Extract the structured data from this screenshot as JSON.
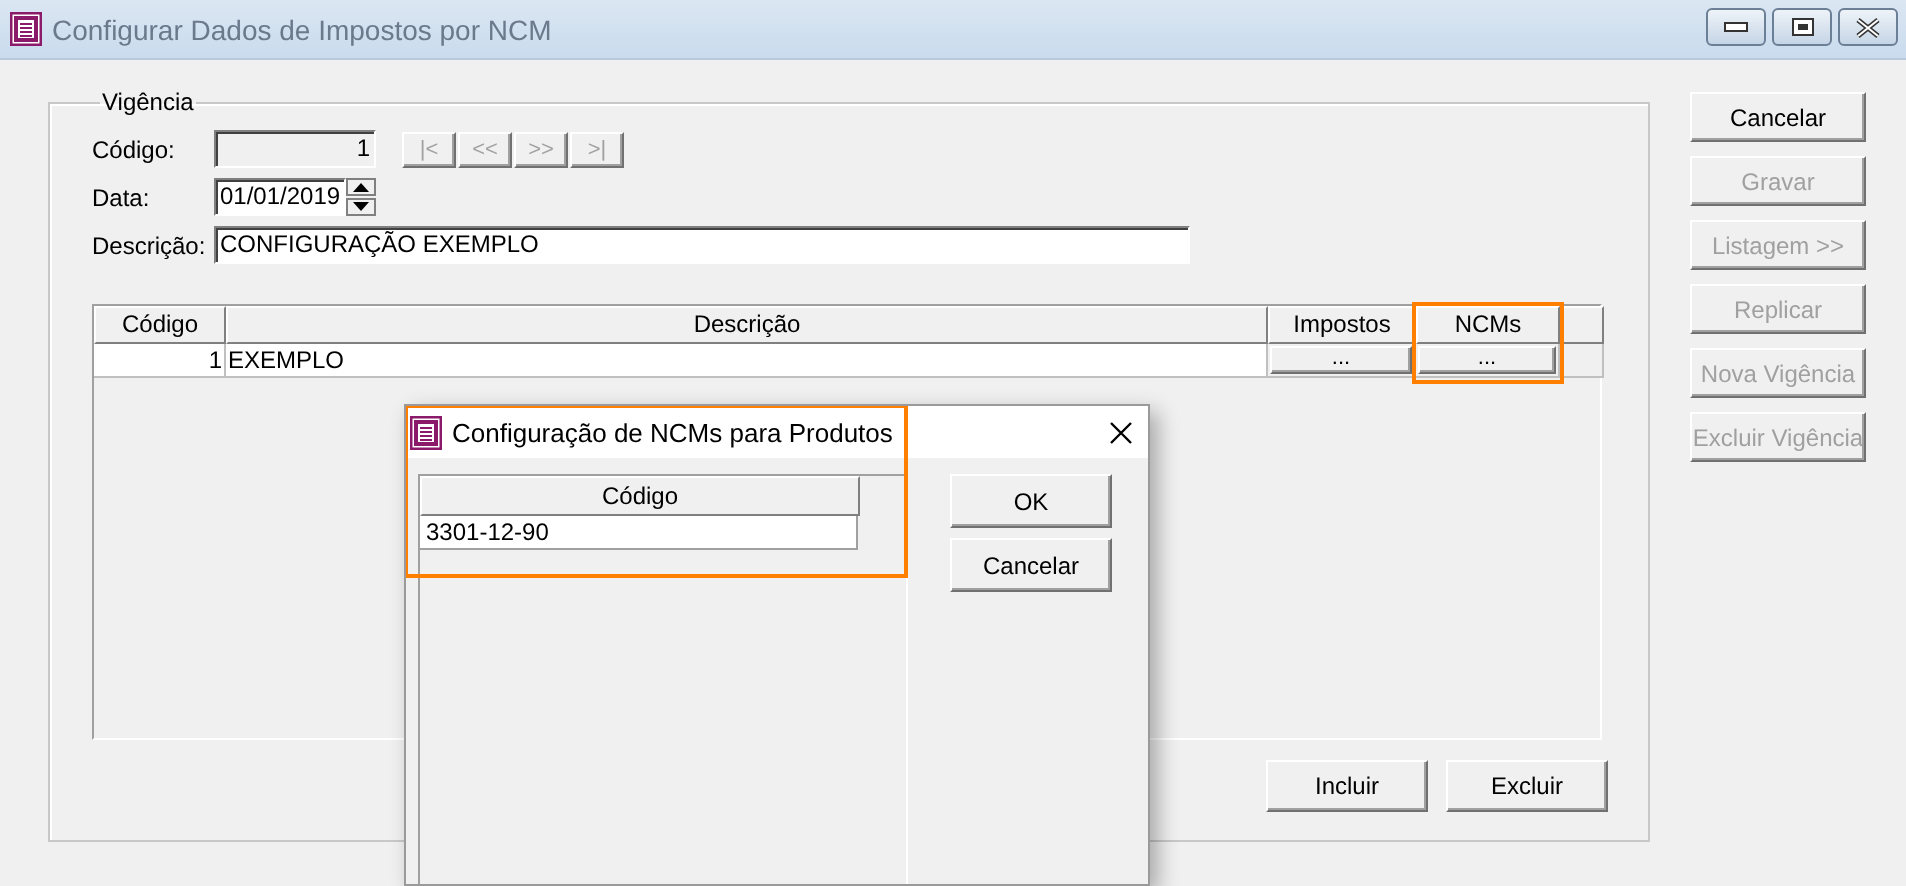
{
  "window": {
    "title": "Configurar Dados de Impostos por NCM"
  },
  "vigencia": {
    "legend": "Vigência",
    "fields": [
      {
        "label": "Código:",
        "value": "1",
        "kind": "readonly"
      },
      {
        "label": "Data:",
        "value": "01/01/2019",
        "kind": "date"
      },
      {
        "label": "Descrição:",
        "value": "CONFIGURAÇÃO EXEMPLO",
        "kind": "text"
      }
    ],
    "nav_buttons": [
      {
        "label": "|<",
        "disabled": true
      },
      {
        "label": "<<",
        "disabled": true
      },
      {
        "label": ">>",
        "disabled": true
      },
      {
        "label": ">|",
        "disabled": true
      }
    ],
    "grid": {
      "columns": [
        {
          "label": "Código",
          "highlighted": false
        },
        {
          "label": "Descrição",
          "highlighted": false
        },
        {
          "label": "Impostos",
          "highlighted": false
        },
        {
          "label": "NCMs",
          "highlighted": true
        }
      ],
      "rows": [
        {
          "cells": [
            {
              "kind": "number",
              "value": "1"
            },
            {
              "kind": "text",
              "value": "EXEMPLO"
            },
            {
              "kind": "button",
              "value": "..."
            },
            {
              "kind": "button",
              "value": "..."
            }
          ]
        }
      ]
    },
    "grid_buttons": [
      {
        "label": "Incluir",
        "disabled": false
      },
      {
        "label": "Excluir",
        "disabled": false
      }
    ]
  },
  "side_buttons": [
    {
      "label": "Cancelar",
      "disabled": false
    },
    {
      "label": "Gravar",
      "disabled": true
    },
    {
      "label": "Listagem >>",
      "disabled": true
    },
    {
      "label": "Replicar",
      "disabled": true
    },
    {
      "label": "Nova Vigência",
      "disabled": true
    },
    {
      "label": "Excluir Vigência",
      "disabled": true
    }
  ],
  "dialog": {
    "title": "Configuração de NCMs para Produtos",
    "highlighted": true,
    "grid": {
      "columns": [
        "Código"
      ],
      "rows": [
        "3301-12-90"
      ]
    },
    "buttons": [
      {
        "label": "OK",
        "disabled": false
      },
      {
        "label": "Cancelar",
        "disabled": false
      }
    ]
  }
}
